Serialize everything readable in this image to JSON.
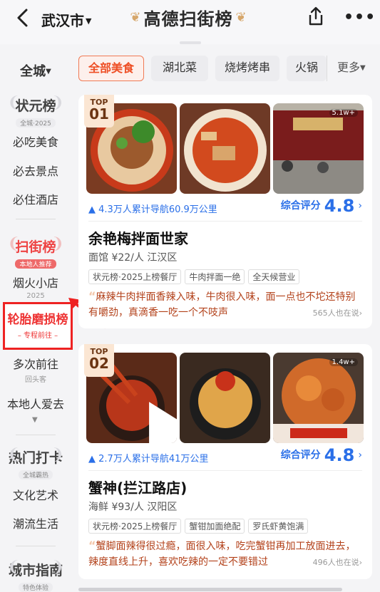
{
  "header": {
    "city": "武汉市",
    "title": "高德扫街榜"
  },
  "sidebar": {
    "region": "全城",
    "group1": {
      "title": "状元榜",
      "sub": "全城·2025"
    },
    "group1_items": [
      "必吃美食",
      "必去景点",
      "必住酒店"
    ],
    "group2": {
      "title": "扫街榜",
      "sub": "本地人推荐"
    },
    "group2_items": [
      {
        "label": "烟火小店",
        "sub": "2025"
      },
      {
        "label": "轮胎磨损榜",
        "sub": "– 专程前往 –"
      },
      {
        "label": "多次前往",
        "sub": "回头客"
      },
      {
        "label": "本地人爱去",
        "sub": ""
      }
    ],
    "group3": {
      "title": "热门打卡",
      "sub": "全城霸热"
    },
    "group3_items": [
      "文化艺术",
      "潮流生活"
    ],
    "group4": {
      "title": "城市指南",
      "sub": "特色体验"
    }
  },
  "tabs": [
    "全部美食",
    "湖北菜",
    "烧烤烤串",
    "火锅",
    "更多"
  ],
  "restaurants": [
    {
      "rank_label": "TOP",
      "rank": "01",
      "photo_views": "5.1w+",
      "nav_stat": "4.3万人累计导航60.9万公里",
      "score_label": "综合评分",
      "score": "4.8",
      "name": "余艳梅拌面世家",
      "meta": "面馆 ¥22/人 江汉区",
      "tags": [
        "状元榜·2025上榜餐厅",
        "牛肉拌面一绝",
        "全天候营业"
      ],
      "review": "麻辣牛肉拌面香辣入味，牛肉很入味，面一点也不坨还特别有嚼劲，真滴香一吃一个不吱声",
      "saying": "565人也在说"
    },
    {
      "rank_label": "TOP",
      "rank": "02",
      "photo_views": "1.4w+",
      "nav_stat": "2.7万人累计导航41万公里",
      "score_label": "综合评分",
      "score": "4.8",
      "name": "蟹神(拦江路店)",
      "meta": "海鲜 ¥93/人 汉阳区",
      "tags": [
        "状元榜·2025上榜餐厅",
        "蟹钳加面绝配",
        "罗氏虾黄饱满"
      ],
      "review": "蟹脚面辣得很过瘾，面很入味，吃完蟹钳再加工放面进去，辣度直线上升，喜欢吃辣的一定不要错过",
      "saying": "496人也在说"
    }
  ],
  "colors": {
    "accent_red": "#e33333",
    "tab_active": "#ee4e24",
    "score_blue": "#2a6fe8",
    "review_text": "#b3421b"
  }
}
